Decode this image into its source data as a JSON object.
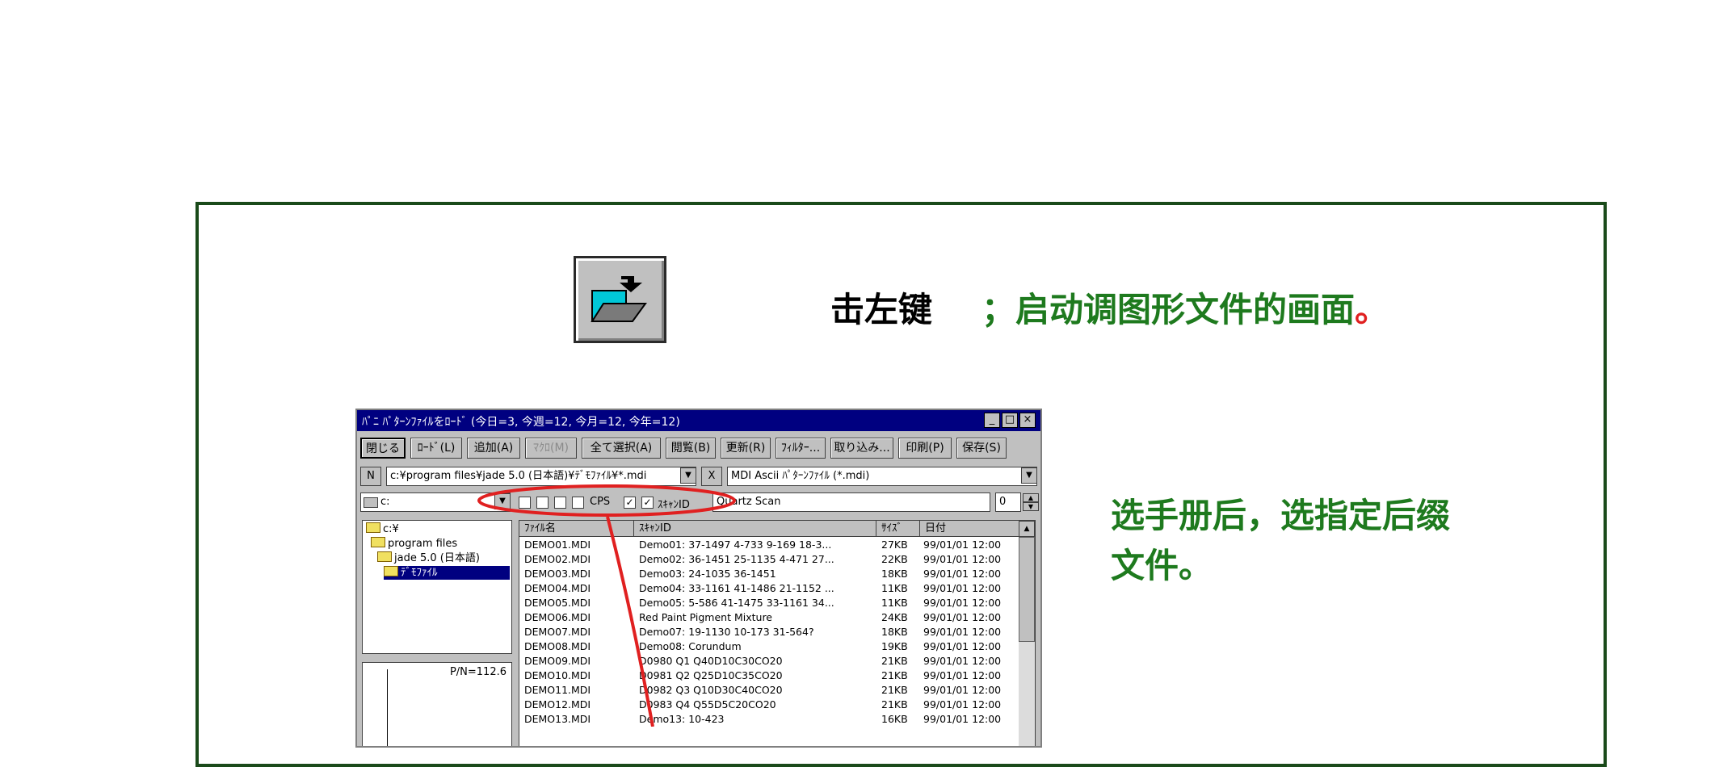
{
  "caption": {
    "action": "击左键",
    "description": "；启动调图形文件的画面",
    "end_mark": "。"
  },
  "note": {
    "line1": "选手册后，选指定后缀",
    "line2": "文件。"
  },
  "dialog": {
    "title": "ﾊﾟﾆ ﾊﾟﾀｰﾝﾌｧｲﾙをﾛｰﾄﾞ (今日=3, 今週=12, 今月=12, 今年=12)",
    "toolbar": [
      "閉じる",
      "ﾛｰﾄﾞ(L)",
      "追加(A)",
      "ﾏｸﾛ(M)",
      "全て選択(A)",
      "閲覧(B)",
      "更新(R)",
      "ﾌｨﾙﾀｰ...",
      "取り込み...",
      "印刷(P)",
      "保存(S)"
    ],
    "n_button": "N",
    "path": "c:¥program files¥jade 5.0 (日本語)¥ﾃﾞﾓﾌｧｲﾙ¥*.mdi",
    "x_button": "X",
    "file_type": "MDI Ascii ﾊﾟﾀｰﾝﾌｧｲﾙ (*.mdi)",
    "drive": "c:",
    "cps_label": "CPS",
    "scan_label": "ｽｷｬﾝID",
    "scan_id": "Quartz Scan",
    "spin_value": "0",
    "tree": [
      "c:¥",
      "program files",
      "jade 5.0 (日本語)",
      "ﾃﾞﾓﾌｧｲﾙ"
    ],
    "preview_label": "P/N=112.6",
    "columns": [
      "ﾌｧｲﾙ名",
      "ｽｷｬﾝID",
      "ｻｲｽﾞ",
      "日付"
    ],
    "rows": [
      [
        "DEMO01.MDI",
        "Demo01: 37-1497 4-733 9-169 18-3...",
        "27KB",
        "99/01/01 12:00"
      ],
      [
        "DEMO02.MDI",
        "Demo02: 36-1451 25-1135 4-471 27...",
        "22KB",
        "99/01/01 12:00"
      ],
      [
        "DEMO03.MDI",
        "Demo03: 24-1035 36-1451",
        "18KB",
        "99/01/01 12:00"
      ],
      [
        "DEMO04.MDI",
        "Demo04: 33-1161 41-1486 21-1152 ...",
        "11KB",
        "99/01/01 12:00"
      ],
      [
        "DEMO05.MDI",
        "Demo05: 5-586 41-1475 33-1161 34...",
        "11KB",
        "99/01/01 12:00"
      ],
      [
        "DEMO06.MDI",
        "Red Paint Pigment Mixture",
        "24KB",
        "99/01/01 12:00"
      ],
      [
        "DEMO07.MDI",
        "Demo07: 19-1130 10-173 31-564?",
        "18KB",
        "99/01/01 12:00"
      ],
      [
        "DEMO08.MDI",
        "Demo08: Corundum",
        "19KB",
        "99/01/01 12:00"
      ],
      [
        "DEMO09.MDI",
        "D0980 Q1 Q40D10C30CO20",
        "21KB",
        "99/01/01 12:00"
      ],
      [
        "DEMO10.MDI",
        "D0981 Q2 Q25D10C35CO20",
        "21KB",
        "99/01/01 12:00"
      ],
      [
        "DEMO11.MDI",
        "D0982 Q3 Q10D30C40CO20",
        "21KB",
        "99/01/01 12:00"
      ],
      [
        "DEMO12.MDI",
        "D0983 Q4 Q55D5C20CO20",
        "21KB",
        "99/01/01 12:00"
      ],
      [
        "DEMO13.MDI",
        "Demo13: 10-423",
        "16KB",
        "99/01/01 12:00"
      ]
    ]
  },
  "colors": {
    "frame": "#1a4a1a",
    "green_text": "#1e7a1e",
    "highlight": "#e02020",
    "titlebar": "#000080"
  }
}
